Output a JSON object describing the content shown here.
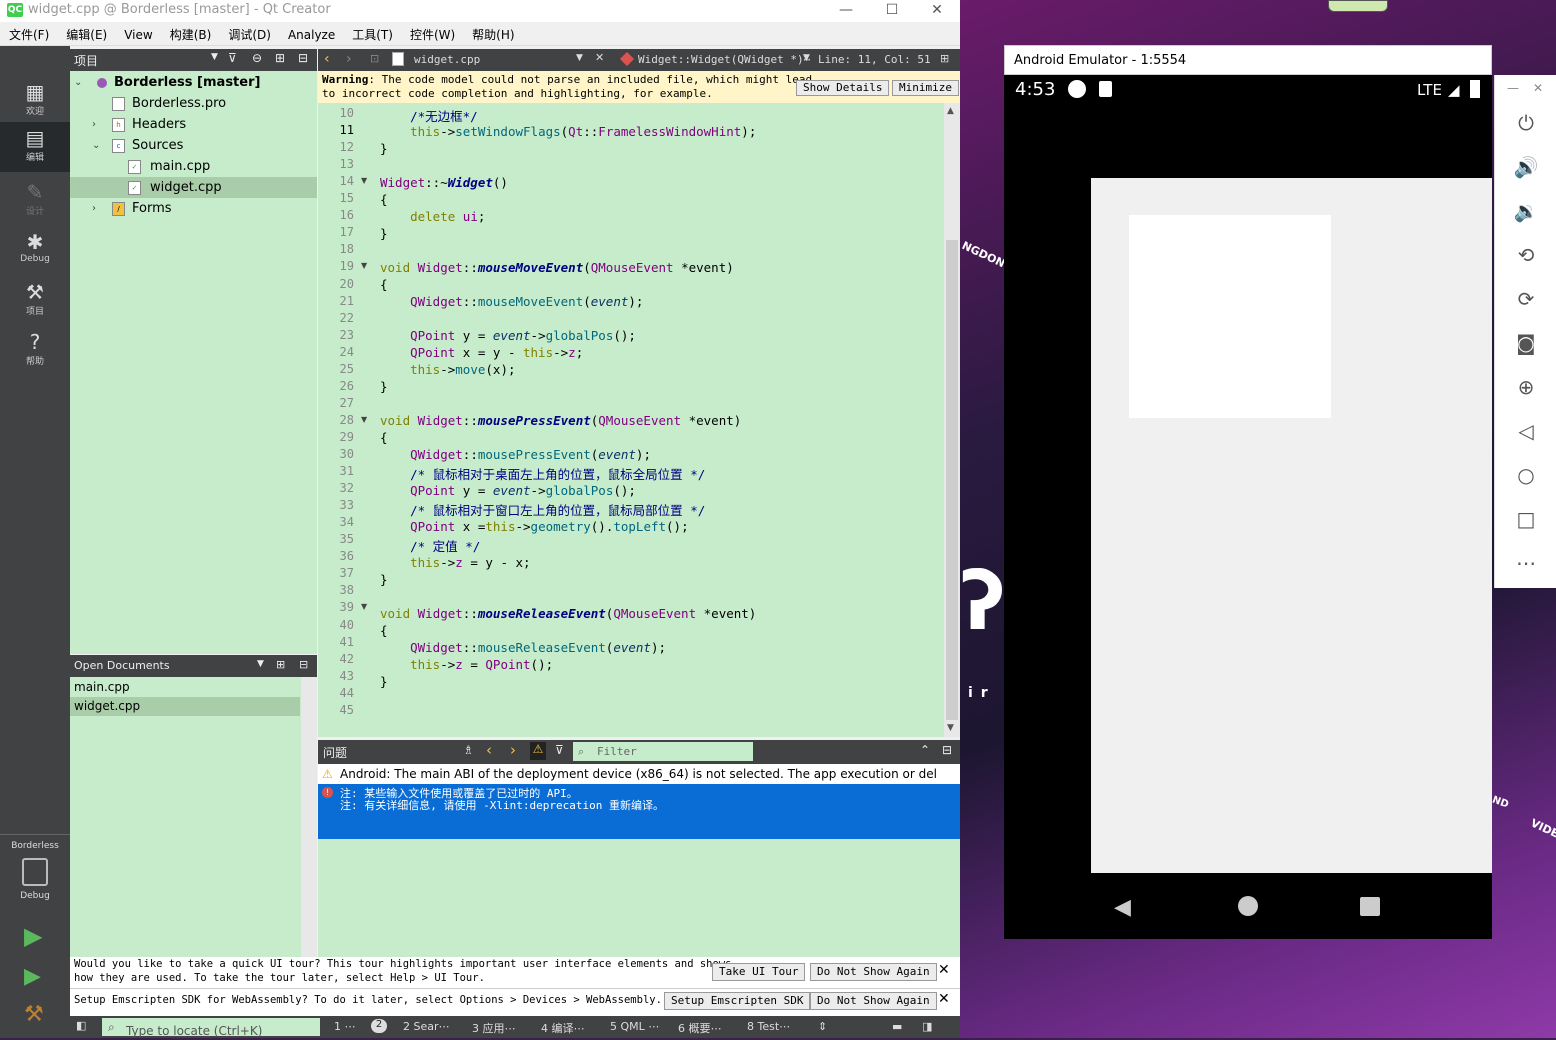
{
  "window": {
    "title": "widget.cpp @ Borderless [master] - Qt Creator",
    "logo": "QC"
  },
  "menu": [
    "文件(F)",
    "编辑(E)",
    "View",
    "构建(B)",
    "调试(D)",
    "Analyze",
    "工具(T)",
    "控件(W)",
    "帮助(H)"
  ],
  "modes": [
    {
      "label": "欢迎",
      "icon": "grid-icon"
    },
    {
      "label": "编辑",
      "icon": "edit-icon"
    },
    {
      "label": "设计",
      "icon": "pencil-icon"
    },
    {
      "label": "Debug",
      "icon": "bug-icon"
    },
    {
      "label": "项目",
      "icon": "wrench-icon"
    },
    {
      "label": "帮助",
      "icon": "help-icon"
    }
  ],
  "kit": {
    "project": "Borderless",
    "config": "Debug"
  },
  "project_panel": {
    "title": "项目",
    "tree": [
      {
        "label": "Borderless [master]",
        "bold": true
      },
      {
        "label": "Borderless.pro"
      },
      {
        "label": "Headers"
      },
      {
        "label": "Sources"
      },
      {
        "label": "main.cpp"
      },
      {
        "label": "widget.cpp"
      },
      {
        "label": "Forms"
      }
    ]
  },
  "open_documents": {
    "title": "Open Documents",
    "items": [
      "main.cpp",
      "widget.cpp"
    ]
  },
  "editor_toolbar": {
    "file": "widget.cpp",
    "symbol": "Widget::Widget(QWidget *)⋯",
    "position": "Line: 11, Col: 51"
  },
  "warning": {
    "label": "Warning",
    "text_line1": ": The code model could not parse an included file, which might lead",
    "text_line2": "to incorrect code completion and highlighting, for example.",
    "show_details": "Show Details",
    "minimize": "Minimize"
  },
  "code": {
    "line_numbers": [
      "10",
      "11",
      "12",
      "13",
      "14",
      "15",
      "16",
      "17",
      "18",
      "19",
      "20",
      "21",
      "22",
      "23",
      "24",
      "25",
      "26",
      "27",
      "28",
      "29",
      "30",
      "31",
      "32",
      "33",
      "34",
      "35",
      "36",
      "37",
      "38",
      "39",
      "40",
      "41",
      "42",
      "43",
      "44",
      "45"
    ],
    "current_line": "11"
  },
  "issues": {
    "title": "问题",
    "filter_placeholder": "Filter",
    "row1": "Android: The main ABI of the deployment device (x86_64) is not selected. The app execution or del",
    "row2_line1": "注: 某些输入文件使用或覆盖了已过时的 API。",
    "row2_line2": "注: 有关详细信息, 请使用 -Xlint:deprecation 重新编译。"
  },
  "tour": {
    "text1": "Would you like to take a quick UI tour? This tour highlights important user interface elements and shows",
    "text2": "how they are used. To take the tour later, select Help > UI Tour.",
    "take_tour": "Take UI Tour",
    "do_not_show": "Do Not Show Again",
    "text3": "Setup Emscripten SDK for WebAssembly? To do it later, select Options > Devices > WebAssembly.",
    "setup_sdk": "Setup Emscripten SDK",
    "do_not_show2": "Do Not Show Again"
  },
  "statusbar": {
    "locate_placeholder": "Type to locate (Ctrl+K)",
    "tabs": [
      "1 ⋯",
      "2",
      "2 Sear⋯",
      "3 应用⋯",
      "4 编译⋯",
      "5 QML ⋯",
      "6 概要⋯",
      "8 Test⋯"
    ]
  },
  "emulator": {
    "title": "Android Emulator - 1:5554",
    "time": "4:53",
    "network": "LTE"
  },
  "desktop_text": [
    "NGDONG",
    "ir",
    "ND",
    "VIDE"
  ]
}
